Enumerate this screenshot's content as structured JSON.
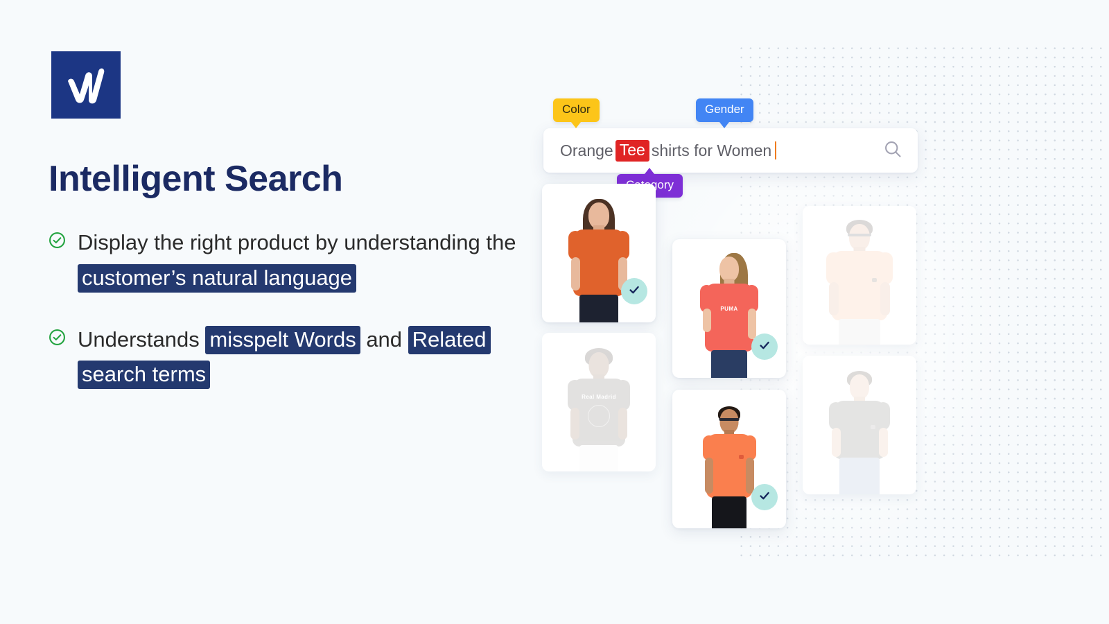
{
  "brand": {
    "logo_icon": "w-logomark",
    "logo_letter": "W",
    "logo_bg": "#1c3684"
  },
  "heading": {
    "title": "Intelligent Search",
    "title_color": "#1b2a63"
  },
  "bullets": [
    {
      "icon": "check-circle-icon",
      "icon_color": "#22a33f",
      "segments": [
        {
          "text": "Display the right product by understanding the ",
          "highlight": false
        },
        {
          "text": "customer’s natural language",
          "highlight": true
        }
      ],
      "plain_text": "Display the right product by understanding the customer’s natural language"
    },
    {
      "icon": "check-circle-icon",
      "icon_color": "#22a33f",
      "segments": [
        {
          "text": "Understands ",
          "highlight": false
        },
        {
          "text": "misspelt Words",
          "highlight": true
        },
        {
          "text": " and ",
          "highlight": false
        },
        {
          "text": "Related search terms",
          "highlight": true
        }
      ],
      "plain_text": "Understands misspelt Words and Related search terms"
    }
  ],
  "highlight_color": "#24396f",
  "search": {
    "query_before": "Orange ",
    "query_token": "Tee",
    "query_after": " shirts for Women",
    "full_query": "Orange Tee shirts for Women",
    "token_color": "#e02424",
    "icon": "search-icon",
    "caret_color": "#f07c1e"
  },
  "tags": [
    {
      "label": "Color",
      "color": "#fcc519",
      "text_color": "#2f2a12",
      "points": "down"
    },
    {
      "label": "Gender",
      "color": "#4285f4",
      "text_color": "#ffffff",
      "points": "down"
    },
    {
      "label": "Category",
      "color": "#7e2fd6",
      "text_color": "#ffffff",
      "points": "up"
    }
  ],
  "results": {
    "badge_icon": "check-icon",
    "badge_bg": "#b6e7e2",
    "badge_check_color": "#17275c",
    "cards": [
      {
        "id": "card-1",
        "alt": "Woman in orange t-shirt",
        "matched": true,
        "shirt_color": "#e0622c",
        "legs_color": "#1d2230",
        "skin": "#e8b99c",
        "hair": "#4c3224",
        "print": ""
      },
      {
        "id": "card-2",
        "alt": "Woman in coral Puma t-shirt",
        "matched": true,
        "shirt_color": "#f4655a",
        "legs_color": "#2a3d63",
        "skin": "#eec3a5",
        "hair": "#9d7744",
        "print": "PUMA"
      },
      {
        "id": "card-3",
        "alt": "Man in peach t-shirt with sunglasses",
        "matched": false,
        "shirt_color": "#f9b183",
        "legs_color": "#d9d9d9",
        "skin": "#d8a07c",
        "hair": "#2b2119",
        "print": ""
      },
      {
        "id": "card-4",
        "alt": "Man in Real Madrid grey t-shirt",
        "matched": false,
        "shirt_color": "#5b564e",
        "legs_color": "#efefef",
        "skin": "#8a5f42",
        "hair": "#231a14",
        "print": "Real Madrid"
      },
      {
        "id": "card-5",
        "alt": "Woman in orange athletic t-shirt",
        "matched": true,
        "shirt_color": "#fa7f4e",
        "legs_color": "#15161b",
        "skin": "#c78b62",
        "hair": "#241a14",
        "print": ""
      },
      {
        "id": "card-6",
        "alt": "Man in grey t-shirt and blue jeans",
        "matched": false,
        "shirt_color": "#5f5e5a",
        "legs_color": "#8fa8c8",
        "skin": "#e2b492",
        "hair": "#3a2b20",
        "print": ""
      }
    ]
  },
  "background": {
    "page_bg": "#f7fafc",
    "dot_color": "#c9d2dc"
  }
}
